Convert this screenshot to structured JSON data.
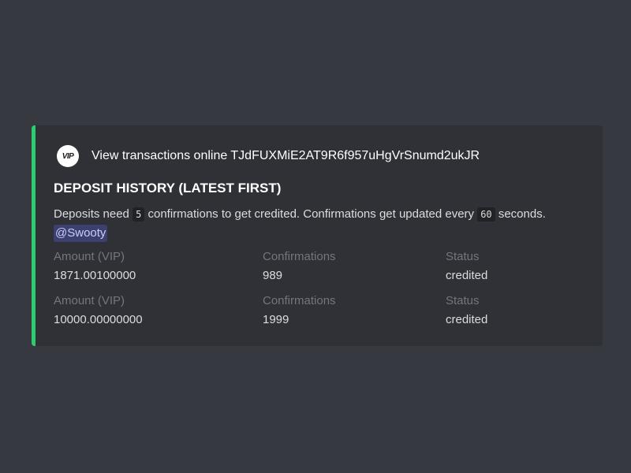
{
  "embed": {
    "accent_color": "#2ecc71",
    "author_icon_text": "VIP",
    "author_name": "View transactions online TJdFUXMiE2AT9R6f957uHgVrSnumd2ukJR",
    "title": "DEPOSIT HISTORY (LATEST FIRST)",
    "description": {
      "part1": "Deposits need ",
      "confirmations_required": "5",
      "part2": " confirmations to get credited. Confirmations get updated every ",
      "update_interval": "60",
      "part3": " seconds.",
      "mention": "@Swooty"
    },
    "deposits": [
      {
        "amount_label": "Amount (VIP)",
        "amount": "1871.00100000",
        "confirmations_label": "Confirmations",
        "confirmations": "989",
        "status_label": "Status",
        "status": "credited"
      },
      {
        "amount_label": "Amount (VIP)",
        "amount": "10000.00000000",
        "confirmations_label": "Confirmations",
        "confirmations": "1999",
        "status_label": "Status",
        "status": "credited"
      }
    ]
  }
}
